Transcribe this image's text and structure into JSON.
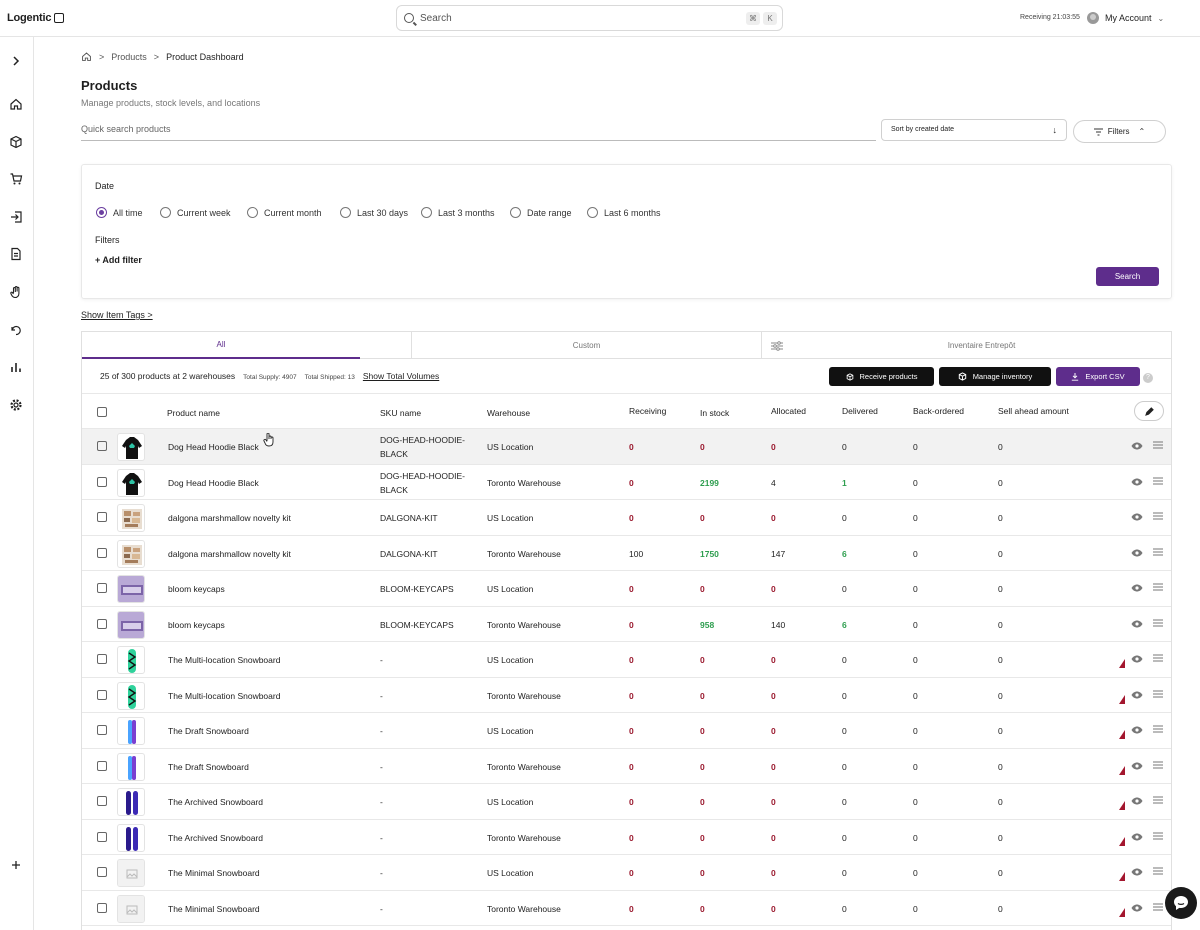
{
  "app": {
    "logo": "Logentic"
  },
  "search": {
    "placeholder": "Search",
    "k1": "⌘",
    "k2": "K"
  },
  "topbar": {
    "receiving": "Receiving 21:03:55",
    "account": "My Account"
  },
  "breadcrumb": {
    "products": "Products",
    "current": "Product Dashboard"
  },
  "page": {
    "title": "Products",
    "subtitle": "Manage products, stock levels, and locations"
  },
  "quick_search": {
    "placeholder": "Quick search products"
  },
  "sort": {
    "label": "Sort by created date"
  },
  "filters_button": "Filters",
  "filter_panel": {
    "date_label": "Date",
    "date_options": [
      "All time",
      "Current week",
      "Current month",
      "Last 30 days",
      "Last 3 months",
      "Date range",
      "Last 6 months"
    ],
    "selected": "All time",
    "filters_label": "Filters",
    "add_filter": "+ Add filter",
    "search_button": "Search"
  },
  "show_item_tags": "Show Item Tags >",
  "tabs": [
    "All",
    "Custom",
    "Inventaire Entrepôt"
  ],
  "summary": {
    "count": "25 of 300 products at 2 warehouses",
    "supply": "Total Supply: 4907",
    "shipped": "Total Shipped: 13",
    "volumes_link": "Show Total Volumes"
  },
  "actions": {
    "receive": "Receive products",
    "manage": "Manage inventory",
    "export": "Export CSV",
    "help": "?"
  },
  "columns": [
    "Product name",
    "SKU name",
    "Warehouse",
    "Receiving",
    "In stock",
    "Allocated",
    "Delivered",
    "Back-ordered",
    "Sell ahead amount"
  ],
  "rows": [
    {
      "name": "Dog Head Hoodie Black",
      "sku": "DOG-HEAD-HOODIE-BLACK",
      "sku1": "DOG-HEAD-HOODIE-",
      "sku2": "BLACK",
      "warehouse": "US Location",
      "receiving": "0",
      "in_stock": "0",
      "allocated": "0",
      "delivered": "0",
      "back_ordered": "0",
      "sell_ahead": "0"
    },
    {
      "name": "Dog Head Hoodie Black",
      "sku": "DOG-HEAD-HOODIE-BLACK",
      "sku1": "DOG-HEAD-HOODIE-",
      "sku2": "BLACK",
      "warehouse": "Toronto Warehouse",
      "receiving": "0",
      "in_stock": "2199",
      "allocated": "4",
      "delivered": "1",
      "back_ordered": "0",
      "sell_ahead": "0"
    },
    {
      "name": "dalgona marshmallow novelty kit",
      "sku": "DALGONA-KIT",
      "warehouse": "US Location",
      "receiving": "0",
      "in_stock": "0",
      "allocated": "0",
      "delivered": "0",
      "back_ordered": "0",
      "sell_ahead": "0"
    },
    {
      "name": "dalgona marshmallow novelty kit",
      "sku": "DALGONA-KIT",
      "warehouse": "Toronto Warehouse",
      "receiving": "100",
      "in_stock": "1750",
      "allocated": "147",
      "delivered": "6",
      "back_ordered": "0",
      "sell_ahead": "0"
    },
    {
      "name": "bloom keycaps",
      "sku": "BLOOM-KEYCAPS",
      "warehouse": "US Location",
      "receiving": "0",
      "in_stock": "0",
      "allocated": "0",
      "delivered": "0",
      "back_ordered": "0",
      "sell_ahead": "0"
    },
    {
      "name": "bloom keycaps",
      "sku": "BLOOM-KEYCAPS",
      "warehouse": "Toronto Warehouse",
      "receiving": "0",
      "in_stock": "958",
      "allocated": "140",
      "delivered": "6",
      "back_ordered": "0",
      "sell_ahead": "0"
    },
    {
      "name": "The Multi-location Snowboard",
      "sku": "-",
      "warehouse": "US Location",
      "receiving": "0",
      "in_stock": "0",
      "allocated": "0",
      "delivered": "0",
      "back_ordered": "0",
      "sell_ahead": "0"
    },
    {
      "name": "The Multi-location Snowboard",
      "sku": "-",
      "warehouse": "Toronto Warehouse",
      "receiving": "0",
      "in_stock": "0",
      "allocated": "0",
      "delivered": "0",
      "back_ordered": "0",
      "sell_ahead": "0"
    },
    {
      "name": "The Draft Snowboard",
      "sku": "-",
      "warehouse": "US Location",
      "receiving": "0",
      "in_stock": "0",
      "allocated": "0",
      "delivered": "0",
      "back_ordered": "0",
      "sell_ahead": "0"
    },
    {
      "name": "The Draft Snowboard",
      "sku": "-",
      "warehouse": "Toronto Warehouse",
      "receiving": "0",
      "in_stock": "0",
      "allocated": "0",
      "delivered": "0",
      "back_ordered": "0",
      "sell_ahead": "0"
    },
    {
      "name": "The Archived Snowboard",
      "sku": "-",
      "warehouse": "US Location",
      "receiving": "0",
      "in_stock": "0",
      "allocated": "0",
      "delivered": "0",
      "back_ordered": "0",
      "sell_ahead": "0"
    },
    {
      "name": "The Archived Snowboard",
      "sku": "-",
      "warehouse": "Toronto Warehouse",
      "receiving": "0",
      "in_stock": "0",
      "allocated": "0",
      "delivered": "0",
      "back_ordered": "0",
      "sell_ahead": "0"
    },
    {
      "name": "The Minimal Snowboard",
      "sku": "-",
      "warehouse": "US Location",
      "receiving": "0",
      "in_stock": "0",
      "allocated": "0",
      "delivered": "0",
      "back_ordered": "0",
      "sell_ahead": "0"
    },
    {
      "name": "The Minimal Snowboard",
      "sku": "-",
      "warehouse": "Toronto Warehouse",
      "receiving": "0",
      "in_stock": "0",
      "allocated": "0",
      "delivered": "0",
      "back_ordered": "0",
      "sell_ahead": "0"
    }
  ],
  "colors": {
    "accent": "#5e2d8c",
    "zero": "#9b1b30",
    "positive": "#2e9e4f",
    "dark_button": "#111111"
  }
}
